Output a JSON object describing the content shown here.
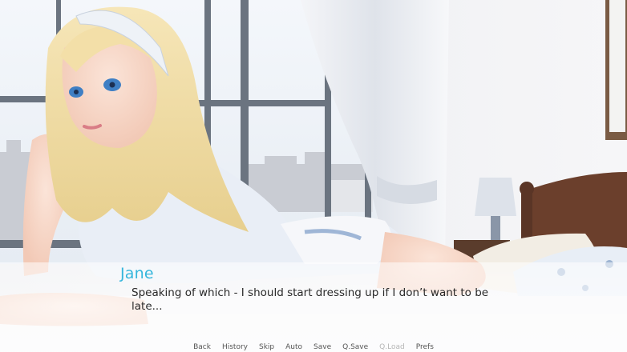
{
  "dialogue": {
    "speaker": "Jane",
    "text": "Speaking of which - I should start dressing up if I don’t want to be late..."
  },
  "quick_menu": {
    "back": "Back",
    "history": "History",
    "skip": "Skip",
    "auto": "Auto",
    "save": "Save",
    "qsave": "Q.Save",
    "qload": "Q.Load",
    "prefs": "Prefs"
  },
  "colors": {
    "speaker": "#35b6dc",
    "menu_text": "#555555",
    "menu_disabled": "#b5b5b5"
  }
}
